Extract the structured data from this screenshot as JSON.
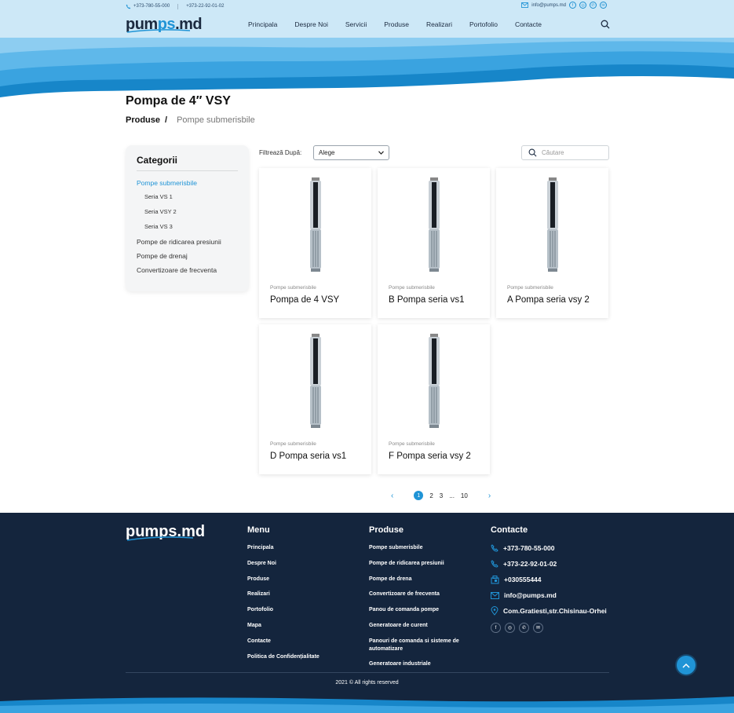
{
  "header": {
    "phone1": "+373-780-55-000",
    "phone2": "+373-22-92-01-02",
    "email": "info@pumps.md",
    "logo_a": "pum",
    "logo_b": "ps",
    "logo_c": ".md",
    "nav": [
      "Principala",
      "Despre Noi",
      "Servicii",
      "Produse",
      "Realizari",
      "Portofolio",
      "Contacte"
    ]
  },
  "page": {
    "title": "Pompa de 4″ VSY",
    "breadcrumb": [
      "Produse",
      "/",
      "Pompe submerisbile"
    ]
  },
  "sidebar": {
    "title": "Categorii",
    "items": [
      {
        "label": "Pompe submerisbile",
        "active": true,
        "sub": false
      },
      {
        "label": "Seria VS 1",
        "sub": true
      },
      {
        "label": "Seria VSY 2",
        "sub": true
      },
      {
        "label": "Seria VS 3",
        "sub": true
      },
      {
        "label": "Pompe de ridicarea presiunii",
        "sub": false
      },
      {
        "label": "Pompe de drenaj",
        "sub": false
      },
      {
        "label": "Convertizoare de frecventa",
        "sub": false
      }
    ]
  },
  "filter": {
    "label": "Filtrează După:",
    "selected": "Alege",
    "search_placeholder": "Căutare"
  },
  "products": [
    {
      "category": "Pompe submerisbile",
      "name": "Pompa de 4 VSY"
    },
    {
      "category": "Pompe submerisbile",
      "name": "B Pompa seria vs1"
    },
    {
      "category": "Pompe submerisbile",
      "name": "A Pompa seria vsy 2"
    },
    {
      "category": "Pompe submerisbile",
      "name": "D Pompa seria vs1"
    },
    {
      "category": "Pompe submerisbile",
      "name": "F Pompa seria vsy 2"
    }
  ],
  "pagination": {
    "current": "1",
    "p2": "2",
    "p3": "3",
    "dots": "...",
    "last": "10"
  },
  "footer": {
    "logo": "pumps.md",
    "menu_title": "Menu",
    "menu": [
      "Principala",
      "Despre Noi",
      "Produse",
      "Realizari",
      "Portofolio",
      "Mapa",
      "Contacte",
      "Politica de Confidențialitate"
    ],
    "products_title": "Produse",
    "products": [
      "Pompe submerisbile",
      "Pompe de ridicarea presiunii",
      "Pompe de drena",
      "Convertizoare de frecventa",
      "Panou de comanda pompe",
      "Generatoare de curent",
      "Panouri de comanda si sisteme de automatizare",
      "Generatoare industriale"
    ],
    "contact_title": "Contacte",
    "contacts": [
      "+373-780-55-000",
      "+373-22-92-01-02",
      "+030555444",
      "info@pumps.md",
      "Com.Gratiesti,str.Chisinau-Orhei"
    ],
    "copyright": "2021 © All rights reserved"
  },
  "colors": {
    "accent": "#2094d6",
    "footer_bg": "#14253d",
    "header_bg": "#cde8f7"
  }
}
